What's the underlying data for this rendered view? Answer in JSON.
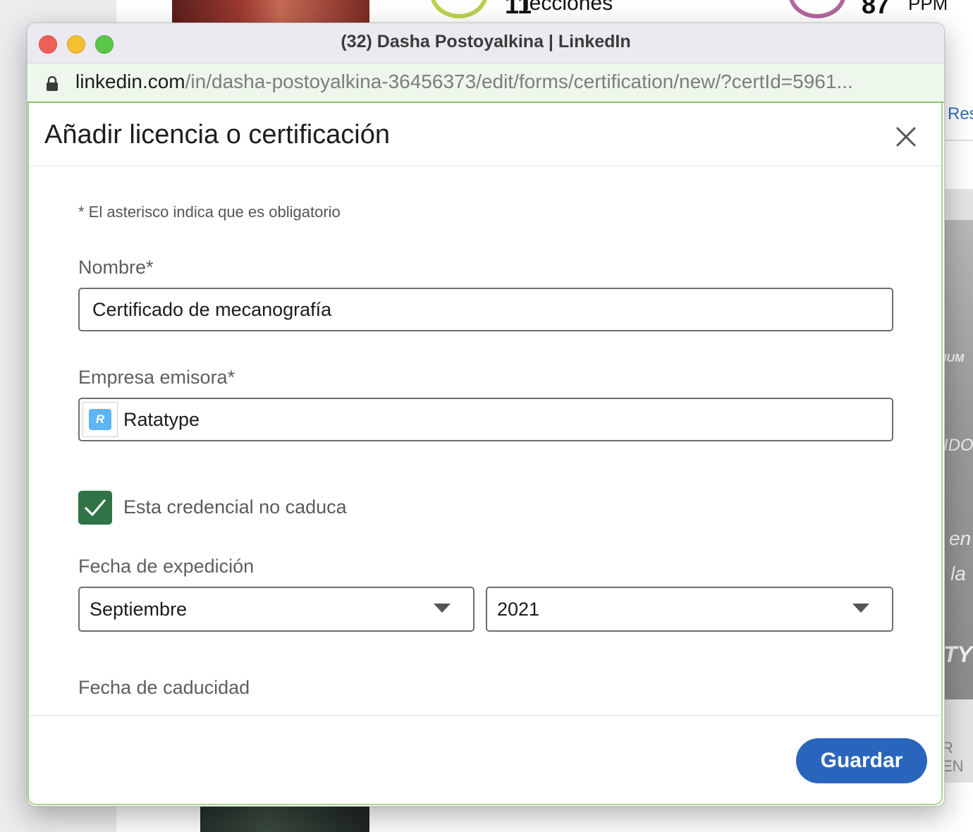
{
  "background": {
    "lessons_count": "11",
    "lessons_label": "lecciones",
    "speed_value": "87",
    "speed_unit": "PPM",
    "side_link": "Res",
    "seal_text_1": "IUM",
    "seal_text_2": "IDO",
    "seal_text_3": "en",
    "seal_text_4": "la",
    "seal_text_5": "TY",
    "bottom_text": "R EN"
  },
  "window": {
    "title": "(32) Dasha Postoyalkina | LinkedIn",
    "url_domain": "linkedin.com",
    "url_path": "/in/dasha-postoyalkina-36456373/edit/forms/certification/new/?certId=5961..."
  },
  "modal": {
    "title": "Añadir licencia o certificación",
    "required_hint": "* El asterisco indica que es obligatorio",
    "name_label": "Nombre*",
    "name_value": "Certificado de mecanografía",
    "org_label": "Empresa emisora*",
    "org_value": "Ratatype",
    "org_logo_letter": "R",
    "no_expiry_label": "Esta credencial no caduca",
    "no_expiry_checked": true,
    "issue_date_label": "Fecha de expedición",
    "issue_month": "Septiembre",
    "issue_year": "2021",
    "expiry_date_label": "Fecha de caducidad",
    "save_label": "Guardar"
  },
  "colors": {
    "accent": "#2a65bd",
    "checkbox": "#2f7346",
    "url_bar": "#eef7ec",
    "focus_outline": "#a7d38e"
  }
}
